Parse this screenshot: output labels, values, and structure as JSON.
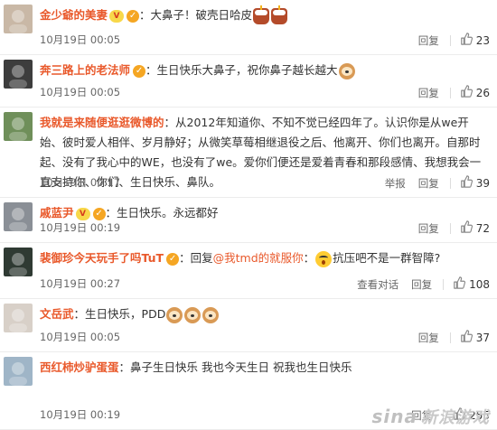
{
  "comments": [
    {
      "username": "金少爺的美妻",
      "has_vip": true,
      "has_badge": true,
      "text": "大鼻子！破壳日哈皮",
      "emojis": [
        "cake",
        "cake"
      ],
      "date": "10月19日 00:05",
      "actions": [
        "回复"
      ],
      "likes": "23",
      "avatar_color": "#c9b8a6"
    },
    {
      "username": "奔三路上的老法师",
      "has_badge": true,
      "text": "生日快乐大鼻子，祝你鼻子越长越大",
      "emojis": [
        "dog"
      ],
      "date": "10月19日 00:05",
      "actions": [
        "回复"
      ],
      "likes": "26",
      "avatar_color": "#3d3d3d"
    },
    {
      "username": "我就是来随便逛逛微博的",
      "text": "从2012年知道你、不知不觉已经四年了。认识你是从we开始、彼时爱人相伴、岁月静好；从微笑草莓相继退役之后、他离开、你们也离开。自那时起、没有了我心中的WE，也没有了we。爱你们便还是爱着青春和那段感情、我想我会一直支持你、你们、生日快乐、鼻队。",
      "date": "10月19日 00:17",
      "actions": [
        "举报",
        "回复"
      ],
      "likes": "39",
      "avatar_color": "#6f8f5a"
    },
    {
      "username": "戚蓝尹",
      "has_vip": true,
      "has_badge": true,
      "text": "生日快乐。永远都好",
      "date": "10月19日 00:19",
      "actions": [
        "回复"
      ],
      "likes": "72",
      "avatar_color": "#8a8f96"
    },
    {
      "username": "裴御珍今天玩手了吗TuT",
      "has_badge": true,
      "reply_prefix": "回复",
      "reply_to": "@我tmd的就服你",
      "text": "抗压吧不是一群智障?",
      "emojis": [
        "shock"
      ],
      "date": "10月19日 00:27",
      "actions": [
        "查看对话",
        "回复"
      ],
      "likes": "108",
      "avatar_color": "#2f3a33"
    },
    {
      "username": "文岳武",
      "text": "生日快乐，PDD",
      "emojis": [
        "dog",
        "dog",
        "dog"
      ],
      "date": "10月19日 00:05",
      "actions": [
        "回复"
      ],
      "likes": "37",
      "avatar_color": "#d8d0c8"
    },
    {
      "username": "西红柿炒驴蛋蛋",
      "text": "鼻子生日快乐 我也今天生日 祝我也生日快乐",
      "date": "10月19日 00:19",
      "actions": [
        "回复"
      ],
      "likes": "255",
      "avatar_color": "#9fb5c7"
    }
  ],
  "watermark": {
    "brand": "sina",
    "text": "新浪游戏"
  },
  "colors": {
    "username": "#e9592b",
    "text": "#333333",
    "meta": "#666666"
  }
}
